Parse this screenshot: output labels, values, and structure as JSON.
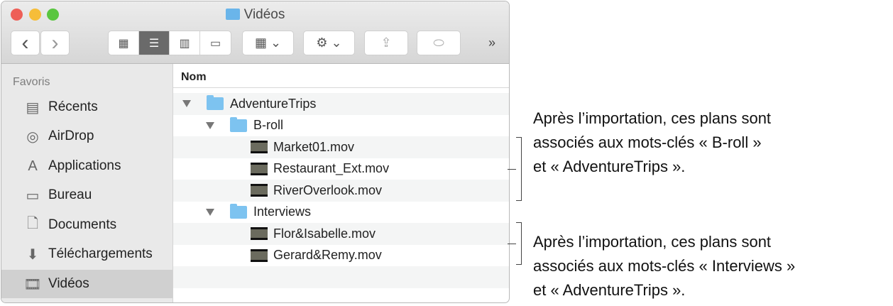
{
  "window": {
    "title": "Vidéos"
  },
  "toolbar": {
    "back": "‹",
    "forward": "›",
    "more": "»"
  },
  "sidebar": {
    "heading": "Favoris",
    "items": [
      {
        "label": "Récents",
        "icon": "recents-icon"
      },
      {
        "label": "AirDrop",
        "icon": "airdrop-icon"
      },
      {
        "label": "Applications",
        "icon": "applications-icon"
      },
      {
        "label": "Bureau",
        "icon": "desktop-icon"
      },
      {
        "label": "Documents",
        "icon": "documents-icon"
      },
      {
        "label": "Téléchargements",
        "icon": "downloads-icon"
      },
      {
        "label": "Vidéos",
        "icon": "movies-icon",
        "selected": true
      }
    ]
  },
  "list": {
    "column": "Nom",
    "rows": [
      {
        "name": "AdventureTrips",
        "type": "folder",
        "level": 0
      },
      {
        "name": "B-roll",
        "type": "folder",
        "level": 1
      },
      {
        "name": "Market01.mov",
        "type": "movie",
        "level": 2
      },
      {
        "name": "Restaurant_Ext.mov",
        "type": "movie",
        "level": 2
      },
      {
        "name": "RiverOverlook.mov",
        "type": "movie",
        "level": 2
      },
      {
        "name": "Interviews",
        "type": "folder",
        "level": 1
      },
      {
        "name": "Flor&Isabelle.mov",
        "type": "movie",
        "level": 2
      },
      {
        "name": "Gerard&Remy.mov",
        "type": "movie",
        "level": 2
      }
    ]
  },
  "annotations": [
    {
      "lines": [
        "Après l’importation, ces plans sont",
        "associés aux mots-clés « B-roll »",
        "et « AdventureTrips »."
      ]
    },
    {
      "lines": [
        "Après l’importation, ces plans sont",
        "associés aux mots-clés « Interviews »",
        "et « AdventureTrips »."
      ]
    }
  ]
}
